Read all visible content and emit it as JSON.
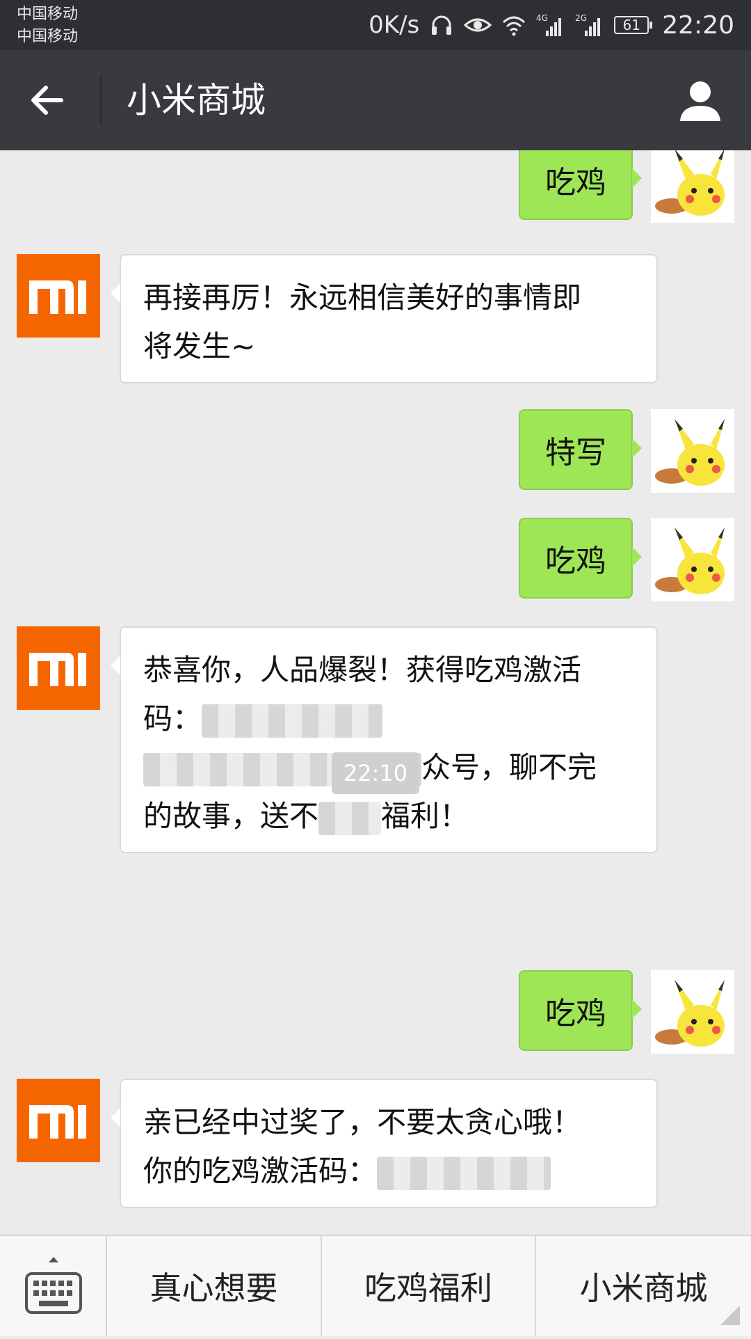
{
  "status_bar": {
    "carrier_1": "中国移动",
    "carrier_2": "中国移动",
    "net_speed": "0K/s",
    "net_4g": "4G",
    "net_2g": "2G",
    "battery": "61",
    "time": "22:20",
    "icons": [
      "headphones-icon",
      "eye-icon",
      "wifi-icon",
      "signal-icon",
      "signal-icon",
      "battery-icon"
    ]
  },
  "nav": {
    "title": "小米商城",
    "back_icon": "arrow-left-icon",
    "profile_icon": "person-icon"
  },
  "messages": [
    {
      "from": "user",
      "text": "吃鸡"
    },
    {
      "from": "bot",
      "line1": "再接再厉！永远相信美好的事情即",
      "line2": "将发生~"
    },
    {
      "from": "user",
      "text": "特写"
    },
    {
      "from": "user",
      "text": "吃鸡"
    },
    {
      "from": "bot",
      "line1": "恭喜你，人品爆裂！获得吃鸡激活",
      "line2": "码：",
      "line3_tail": "众号，聊不完",
      "line4_head": "的故事，送不",
      "line4_tail": "福利！"
    },
    {
      "from": "time",
      "text": "22:10"
    },
    {
      "from": "user",
      "text": "吃鸡"
    },
    {
      "from": "bot",
      "line1": "亲已经中过奖了，不要太贪心哦！",
      "line2": "你的吃鸡激活码："
    }
  ],
  "menu": {
    "keyboard_icon": "keyboard-icon",
    "items": [
      "真心想要",
      "吃鸡福利",
      "小米商城"
    ]
  },
  "colors": {
    "brand_mi": "#f56600",
    "bubble_green": "#9fe657",
    "nav_bg": "#393a3f"
  }
}
